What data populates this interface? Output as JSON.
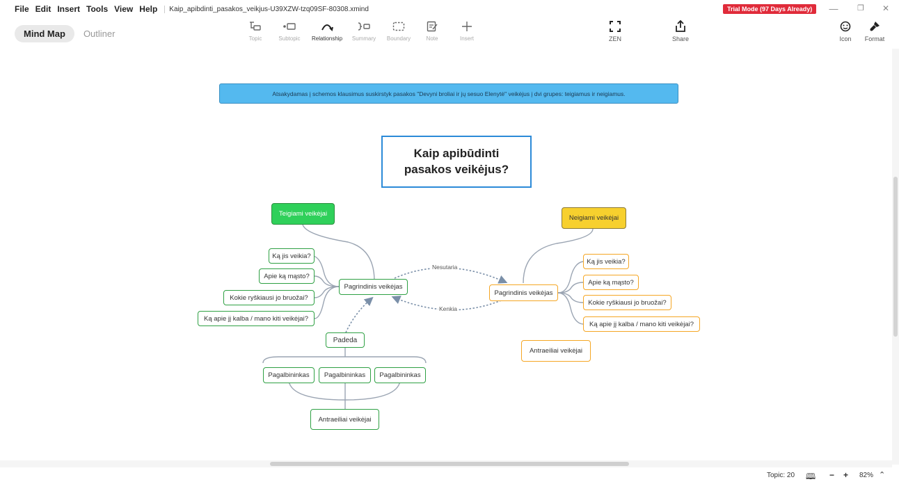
{
  "menu": {
    "items": [
      "File",
      "Edit",
      "Insert",
      "Tools",
      "View",
      "Help"
    ],
    "file_title": "Kaip_apibdinti_pasakos_veikjus-U39XZW-tzq09SF-80308.xmind",
    "trial_badge": "Trial Mode (97 Days Already)"
  },
  "window": {
    "minimize": "—",
    "restore": "❐",
    "close": "✕"
  },
  "views": {
    "mind_map": "Mind Map",
    "outliner": "Outliner"
  },
  "toolbar": {
    "topic": "Topic",
    "subtopic": "Subtopic",
    "relationship": "Relationship",
    "summary": "Summary",
    "boundary": "Boundary",
    "note": "Note",
    "insert": "Insert",
    "zen": "ZEN",
    "share": "Share",
    "icon": "Icon",
    "format": "Format"
  },
  "map": {
    "instruction": "Atsakydamas į schemos klausimus suskirstyk pasakos \"Devyni broliai ir jų sesuo Elenytė\" veikėjus į dvi grupes: teigiamus ir neigiamus.",
    "central_line1": "Kaip apibūdinti",
    "central_line2": "pasakos veikėjus?",
    "teigiami": "Teigiami veikėjai",
    "neigiami": "Neigiami veikėjai",
    "left_main": "Pagrindinis veikėjas",
    "right_main": "Pagrindinis veikėjas",
    "left_questions": [
      "Ką jis veikia?",
      "Apie ką mąsto?",
      "Kokie ryškiausi jo bruožai?",
      "Ką apie jį kalba / mano kiti veikėjai?"
    ],
    "right_questions": [
      "Ką jis veikia?",
      "Apie ką mąsto?",
      "Kokie ryškiausi jo bruožai?",
      "Ką apie jį kalba / mano kiti veikėjai?"
    ],
    "padeda": "Padeda",
    "helpers": [
      "Pagalbininkas",
      "Pagalbininkas",
      "Pagalbininkas"
    ],
    "left_secondary": "Antraeiliai veikėjai",
    "right_secondary": "Antraeiliai veikėjai",
    "rel_nesutaria": "Nesutaria",
    "rel_kenkia": "Kenkia"
  },
  "status": {
    "topic_count": "Topic: 20",
    "zoom": "82%",
    "zoom_minus": "−",
    "zoom_plus": "+",
    "map_icon": "🕮",
    "stepper": "⌃"
  }
}
